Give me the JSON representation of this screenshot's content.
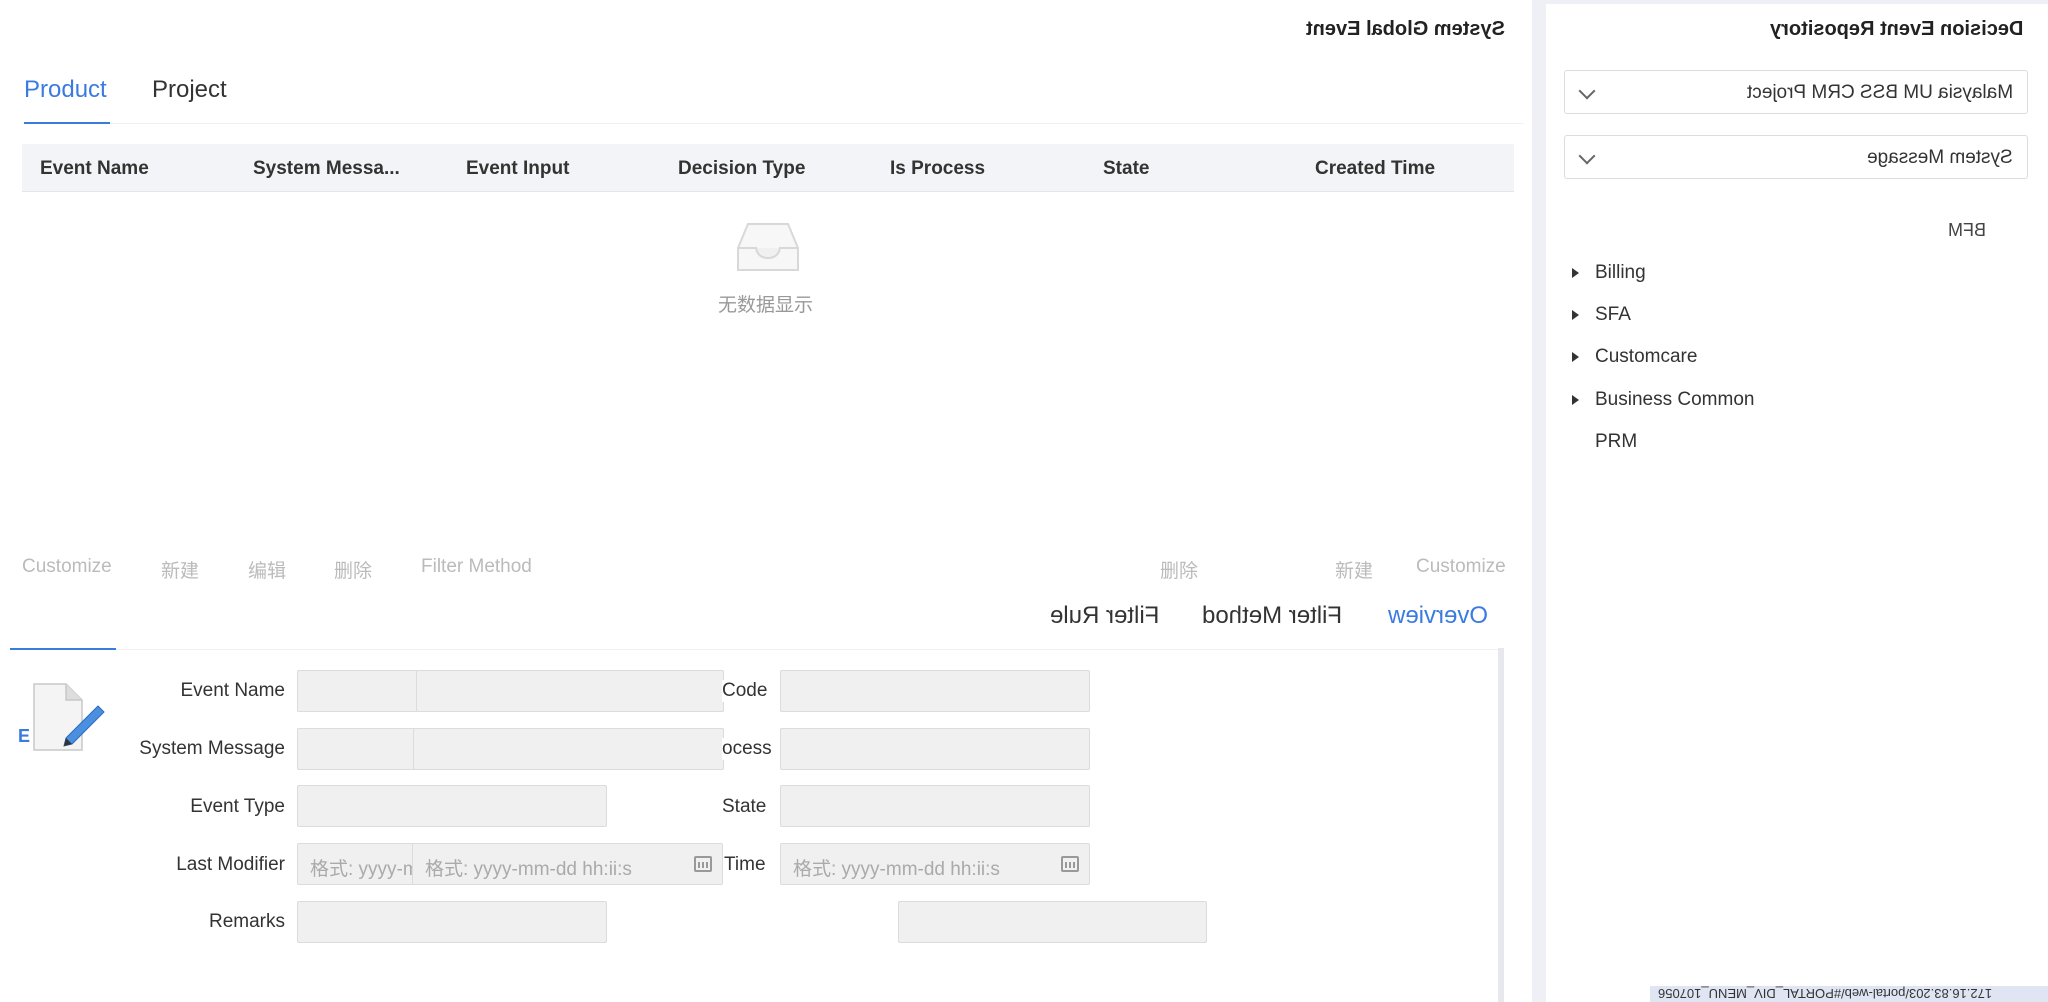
{
  "main": {
    "title": "System Global Event",
    "tabs": [
      {
        "label": "Product",
        "active": true
      },
      {
        "label": "Project",
        "active": false
      }
    ],
    "table": {
      "columns": [
        "Event Name",
        "System Messa...",
        "Event Input",
        "Decision Type",
        "Is Process",
        "State",
        "Created Time"
      ],
      "rows": [],
      "empty_text": "无数据显示"
    },
    "toolbar_left": [
      "Customize",
      "新建",
      "编辑",
      "删除",
      "Filter Method"
    ],
    "toolbar_right": [
      "删除",
      "新建",
      "Customize"
    ],
    "sub_tabs": [
      {
        "label": "Overview",
        "active": true
      },
      {
        "label": "Filter Method",
        "active": false
      },
      {
        "label": "Filter Rule",
        "active": false
      }
    ],
    "form": {
      "icon_letter": "E",
      "labels": {
        "event_name": "Event Name",
        "system_message": "System Message",
        "event_type": "Event Type",
        "last_modifier": "Last Modifier",
        "remarks": "Remarks",
        "code": "Code",
        "process": "ocess",
        "state": "State",
        "time": "Time"
      },
      "placeholders": {
        "last_modifier": "格式: yyyy-mm-dd hh:ii:s",
        "modified_time": "格式: yyyy-mm-dd hh:ii:s",
        "created_time": "格式: yyyy-mm-dd hh:ii:s"
      }
    }
  },
  "sidebar": {
    "title": "Decision Event Repository",
    "project_select": "Malaysia UM BSS CRM Project",
    "type_select": "System Message",
    "group_label": "BFM",
    "tree": [
      {
        "label": "Billing",
        "expandable": true
      },
      {
        "label": "SFA",
        "expandable": true
      },
      {
        "label": "Customcare",
        "expandable": true
      },
      {
        "label": "Business Common",
        "expandable": true
      },
      {
        "label": "PRM",
        "expandable": false
      }
    ]
  },
  "status_url": "172.16.83.203/portal-web/#PORTAL_DIV_MENU_107056",
  "colors": {
    "accent": "#3a7be0",
    "muted": "#bbbbbb",
    "background": "#eef0f5"
  }
}
